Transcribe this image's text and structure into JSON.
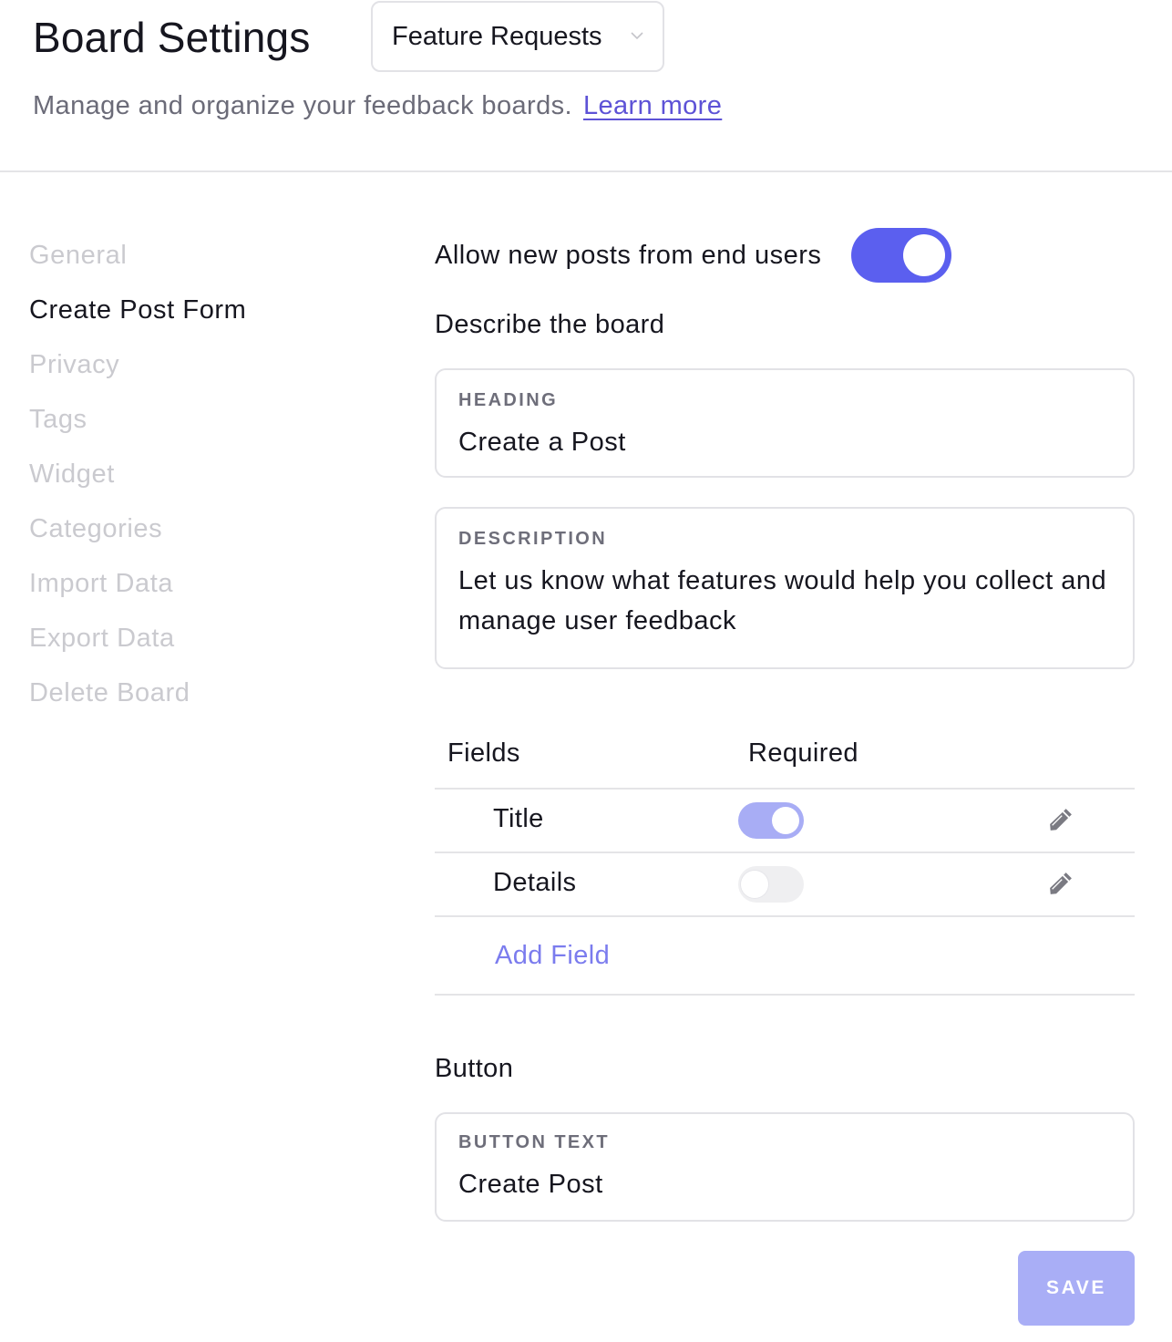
{
  "header": {
    "title": "Board Settings",
    "board_select": {
      "value": "Feature Requests",
      "icon": "chevron-down-icon"
    },
    "subtitle": "Manage and organize your feedback boards.",
    "learn_more": "Learn more"
  },
  "sidebar": {
    "items": [
      {
        "label": "General",
        "active": false
      },
      {
        "label": "Create Post Form",
        "active": true
      },
      {
        "label": "Privacy",
        "active": false
      },
      {
        "label": "Tags",
        "active": false
      },
      {
        "label": "Widget",
        "active": false
      },
      {
        "label": "Categories",
        "active": false
      },
      {
        "label": "Import Data",
        "active": false
      },
      {
        "label": "Export Data",
        "active": false
      },
      {
        "label": "Delete Board",
        "active": false
      }
    ]
  },
  "main": {
    "allow_posts": {
      "label": "Allow new posts from end users",
      "enabled": true
    },
    "describe_label": "Describe the board",
    "heading_field": {
      "caption": "HEADING",
      "value": "Create a Post"
    },
    "description_field": {
      "caption": "DESCRIPTION",
      "value": "Let us know what features would help you collect and manage user feedback"
    },
    "fields": {
      "col_fields": "Fields",
      "col_required": "Required",
      "rows": [
        {
          "name": "Title",
          "required": true,
          "edit_icon": "pencil-icon"
        },
        {
          "name": "Details",
          "required": false,
          "edit_icon": "pencil-icon"
        }
      ],
      "add_field": "Add Field"
    },
    "button_label": "Button",
    "button_text_field": {
      "caption": "BUTTON TEXT",
      "value": "Create Post"
    },
    "save": "SAVE"
  },
  "colors": {
    "accent": "#5b5fef",
    "accent_light": "#a9aef6",
    "link": "#5d52d6",
    "text": "#16161f",
    "muted": "#cacacf"
  }
}
